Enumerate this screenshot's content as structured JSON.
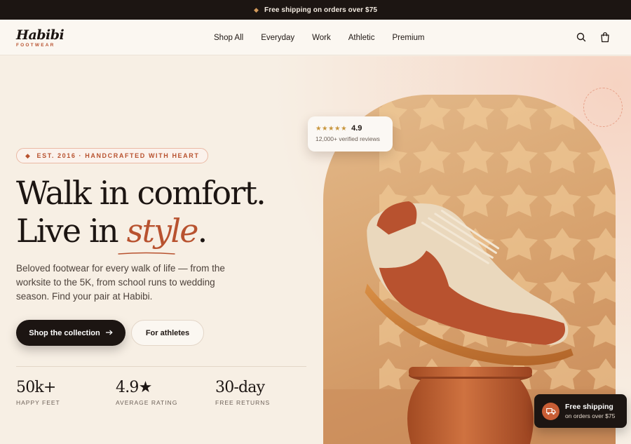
{
  "announcement": {
    "icon": "sparkle-icon",
    "text": "Free shipping on orders over $75"
  },
  "brand": {
    "name": "Habibi",
    "tagline": "FOOTWEAR"
  },
  "nav": {
    "links": [
      "Shop All",
      "Everyday",
      "Work",
      "Athletic",
      "Premium"
    ],
    "icons": [
      "search-icon",
      "shopping-bag-icon"
    ]
  },
  "hero": {
    "badge": "EST. 2016 · HANDCRAFTED WITH HEART",
    "headline_line1": "Walk in comfort.",
    "headline_line2_pre": "Live in ",
    "headline_line2_accent": "style",
    "headline_line2_post": ".",
    "body": "Beloved footwear for every walk of life — from the worksite to the 5K, from school runs to wedding season. Find your pair at Habibi.",
    "primary_cta": "Shop the collection",
    "secondary_cta": "For athletes",
    "stats": [
      {
        "value": "50k+",
        "label": "HAPPY FEET"
      },
      {
        "value": "4.9★",
        "label": "AVERAGE RATING"
      },
      {
        "value": "30-day",
        "label": "FREE RETURNS"
      }
    ]
  },
  "review_card": {
    "stars": "★★★★★",
    "score": "4.9",
    "count": "12,000+ verified reviews"
  },
  "toast": {
    "icon": "truck-icon",
    "title": "Free shipping",
    "subtitle": "on orders over $75"
  },
  "colors": {
    "accent": "#b8522f",
    "dark": "#1c1512",
    "background": "#f7efe4"
  }
}
